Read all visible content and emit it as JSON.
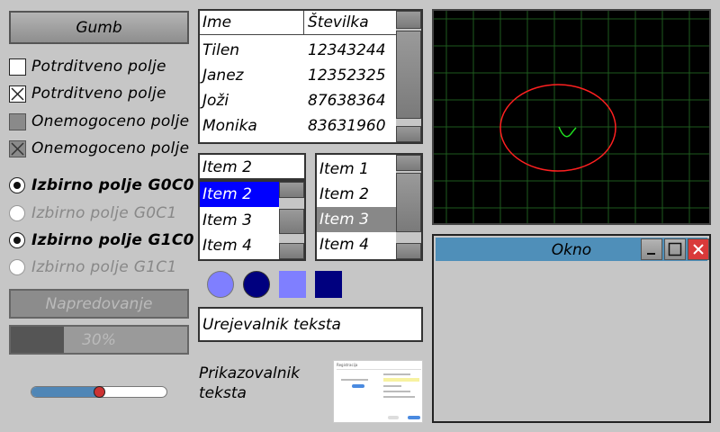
{
  "button": {
    "label": "Gumb"
  },
  "checkboxes": [
    {
      "label": "Potrditveno polje",
      "checked": false,
      "disabled": false
    },
    {
      "label": "Potrditveno polje",
      "checked": true,
      "disabled": false
    },
    {
      "label": "Onemogoceno polje",
      "checked": false,
      "disabled": true
    },
    {
      "label": "Onemogoceno polje",
      "checked": true,
      "disabled": true
    }
  ],
  "radios": [
    {
      "label": "Izbirno polje G0C0",
      "selected": true,
      "disabled": false
    },
    {
      "label": "Izbirno polje G0C1",
      "selected": false,
      "disabled": true
    },
    {
      "label": "Izbirno polje G1C0",
      "selected": true,
      "disabled": false
    },
    {
      "label": "Izbirno polje G1C1",
      "selected": false,
      "disabled": true
    }
  ],
  "progress1": {
    "label": "Napredovanje",
    "value": 0.0
  },
  "progress2": {
    "label": "30%",
    "value": 0.3
  },
  "slider": {
    "value": 0.5,
    "accent": "#4f86b6",
    "knob": "#cc3333"
  },
  "table": {
    "headers": [
      "Ime",
      "Številka"
    ],
    "rows": [
      [
        "Tilen",
        "12343244"
      ],
      [
        "Janez",
        "12352325"
      ],
      [
        "Joži",
        "87638364"
      ],
      [
        "Monika",
        "83631960"
      ]
    ]
  },
  "combo": {
    "value": "Item 2",
    "items": [
      "Item 2",
      "Item 3",
      "Item 4"
    ],
    "selected_index": 0
  },
  "listbox": {
    "items": [
      "Item 1",
      "Item 2",
      "Item 3",
      "Item 4"
    ],
    "selected_index": 2
  },
  "shapes": {
    "light": "#7f7fff",
    "dark": "#00007f"
  },
  "text_editor": {
    "value": "Urejevalnik teksta"
  },
  "text_viewer": {
    "value": "Prikazovalnik teksta"
  },
  "scope": {
    "bg": "#000000",
    "grid": "#1e5a1e",
    "ellipse": "#ff2020",
    "curve": "#20e020"
  },
  "window": {
    "title": "Okno",
    "titlebar": "#4f8fb9"
  },
  "thumbnail": {
    "title": "Registracija"
  }
}
